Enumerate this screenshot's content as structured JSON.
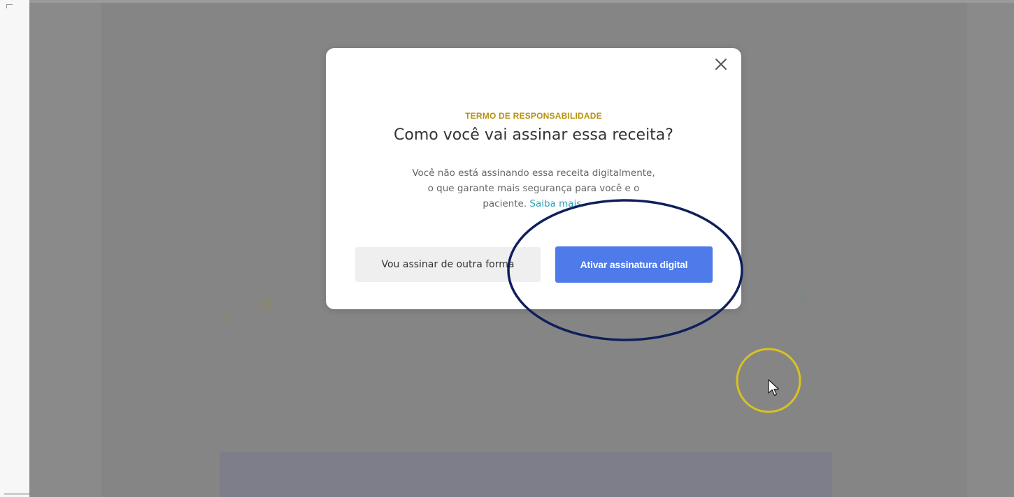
{
  "modal": {
    "eyebrow": "TERMO DE RESPONSABILIDADE",
    "title": "Como você vai assinar essa receita?",
    "description_line1": "Você não está assinando essa receita digitalmente,",
    "description_line2": "o que garante mais segurança para você e o",
    "description_line3_prefix": "paciente. ",
    "learn_more_link": "Saiba mais.",
    "secondary_button": "Vou assinar de outra forma",
    "primary_button": "Ativar assinatura digital",
    "close_icon": "close-icon"
  },
  "colors": {
    "eyebrow": "#b8920f",
    "primary_button": "#4e7be9",
    "secondary_button": "#efefef",
    "link": "#2aa0b8",
    "annotation_ellipse": "#0f1f5a",
    "cursor_highlight": "#d9c21f"
  }
}
